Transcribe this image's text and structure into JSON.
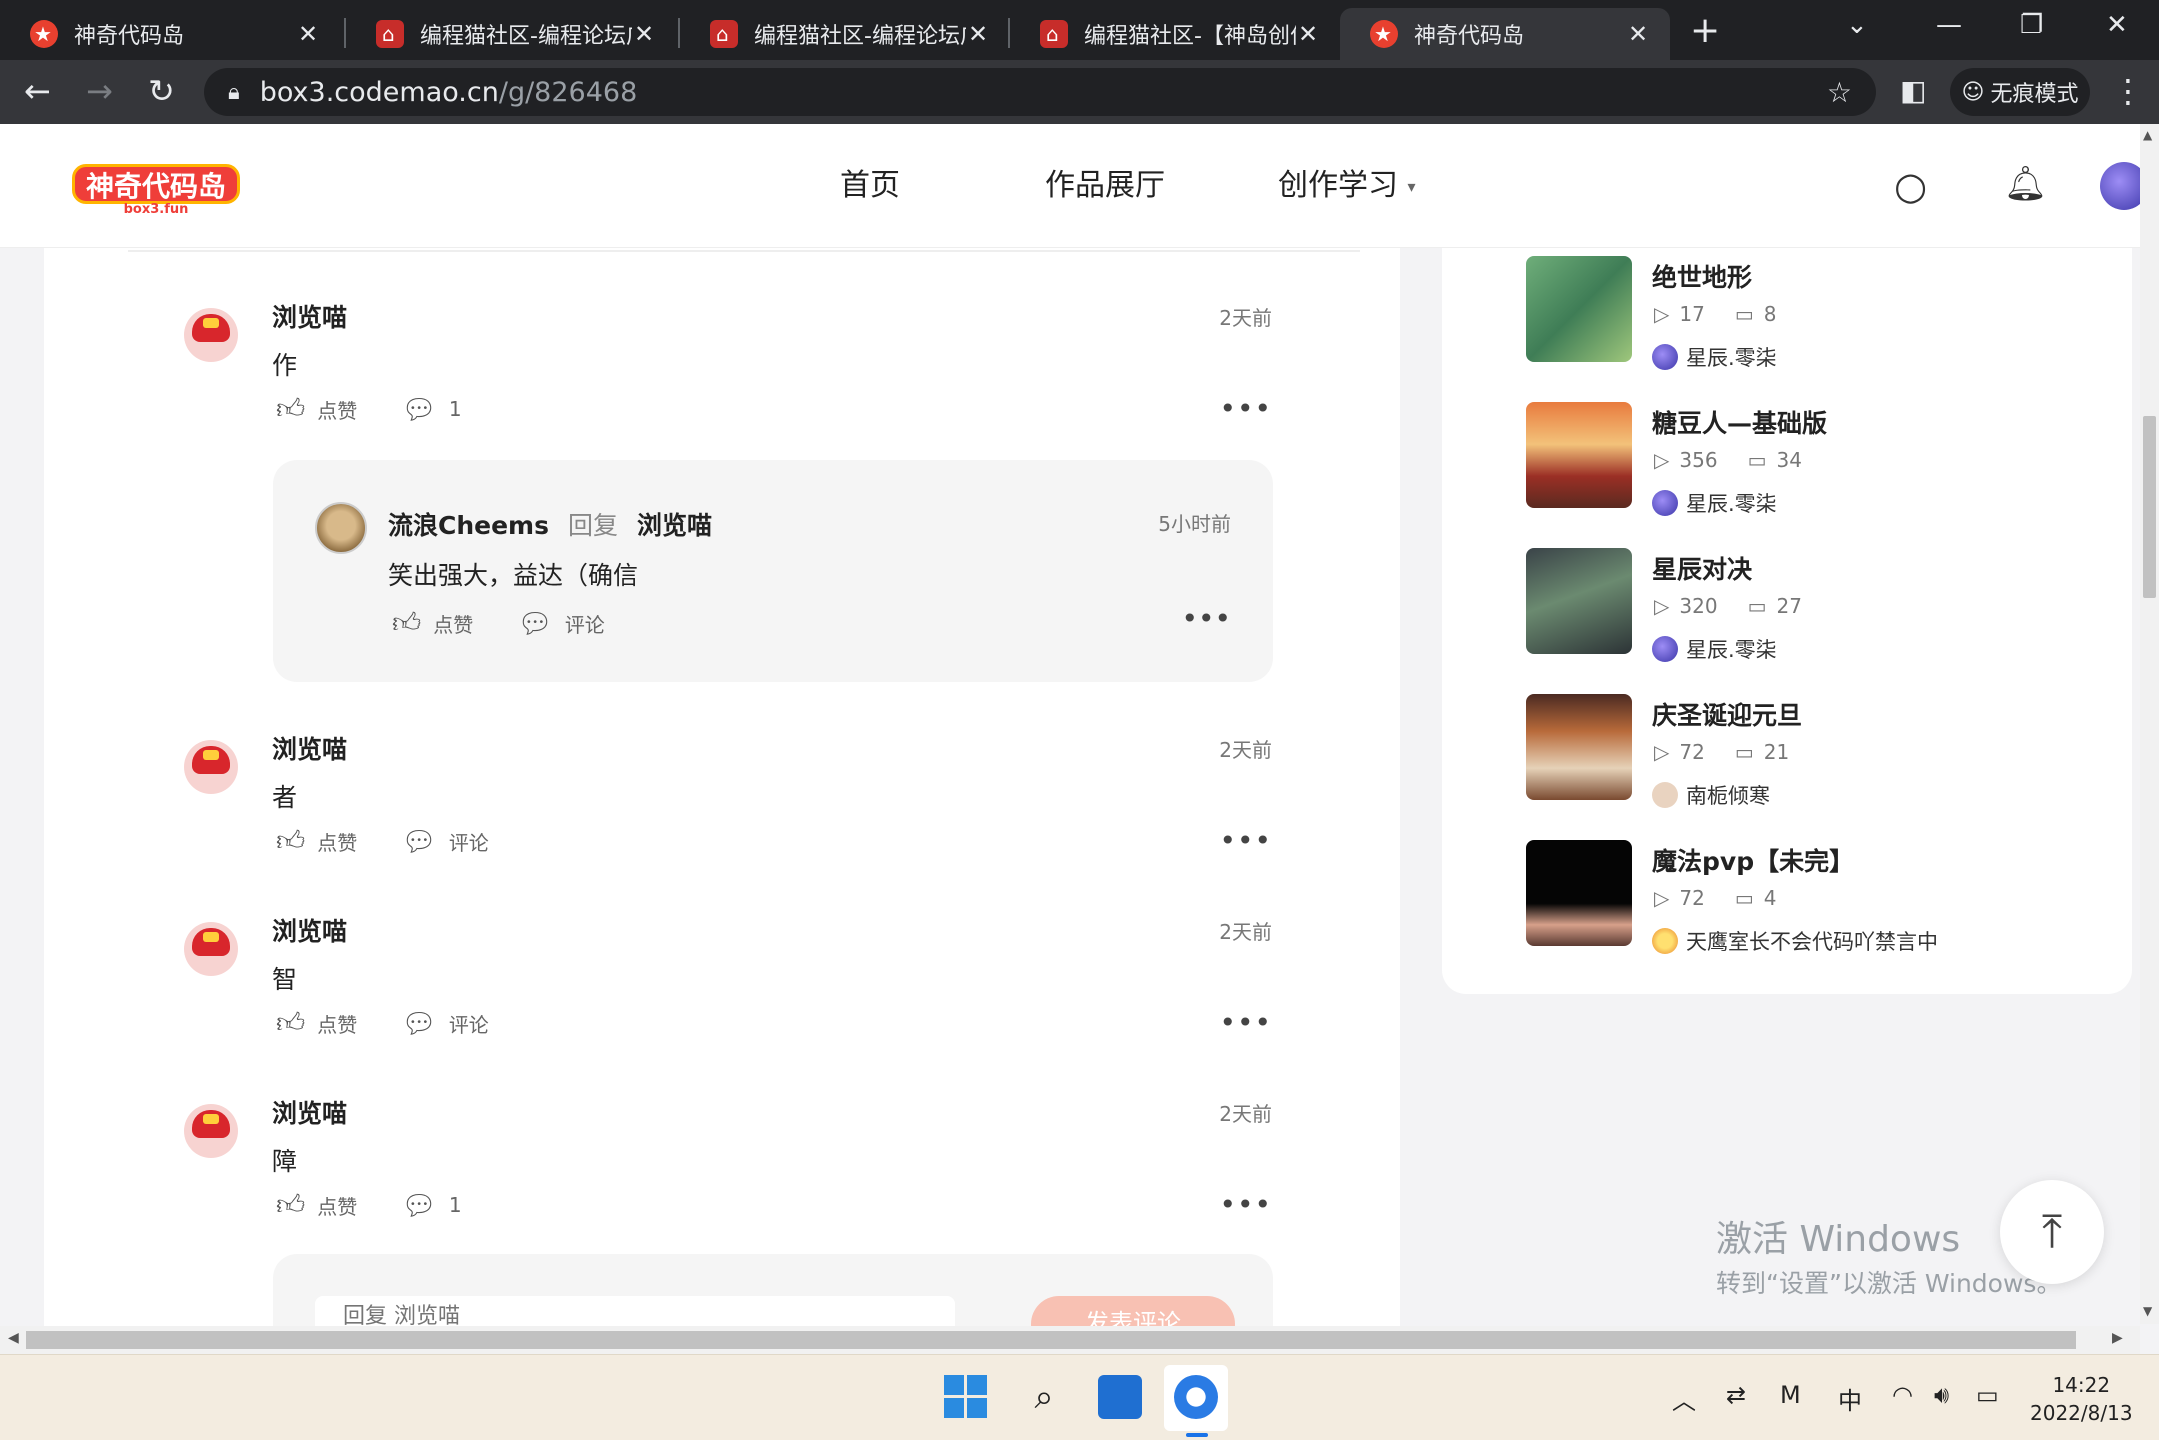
{
  "browser": {
    "tabs": [
      {
        "title": "神奇代码岛",
        "close": "✕",
        "icon": "star-favicon"
      },
      {
        "title": "编程猫社区-编程论坛广",
        "close": "✕",
        "icon": "codemao-favicon"
      },
      {
        "title": "编程猫社区-编程论坛广",
        "close": "✕",
        "icon": "codemao-favicon"
      },
      {
        "title": "编程猫社区-【神岛创作",
        "close": "✕",
        "icon": "codemao-favicon"
      },
      {
        "title": "神奇代码岛",
        "close": "✕",
        "icon": "star-favicon"
      }
    ],
    "new_tab": "+",
    "url_host": "box3.codemao.cn",
    "url_path": "/g/826468",
    "incognito_label": "无痕模式"
  },
  "site": {
    "logo_text": "神奇代码岛",
    "logo_sub": "box3.fun",
    "nav": [
      {
        "label": "首页"
      },
      {
        "label": "作品展厅"
      },
      {
        "label": "创作学习",
        "caret": "▾"
      }
    ]
  },
  "comments": [
    {
      "user": "浏览喵",
      "time": "2天前",
      "text": "作",
      "like_label": "点赞",
      "comment_label": "1",
      "reply": {
        "user": "流浪Cheems",
        "reply_word": "回复",
        "target": "浏览喵",
        "time": "5小时前",
        "text": "笑出强大，益达（确信",
        "like_label": "点赞",
        "comment_label": "评论"
      }
    },
    {
      "user": "浏览喵",
      "time": "2天前",
      "text": "者",
      "like_label": "点赞",
      "comment_label": "评论"
    },
    {
      "user": "浏览喵",
      "time": "2天前",
      "text": "智",
      "like_label": "点赞",
      "comment_label": "评论"
    },
    {
      "user": "浏览喵",
      "time": "2天前",
      "text": "障",
      "like_label": "点赞",
      "comment_label": "1"
    }
  ],
  "compose": {
    "placeholder": "回复 浏览喵",
    "submit_label": "发表评论"
  },
  "related_games": [
    {
      "title": "绝世地形",
      "plays": "17",
      "comments": "8",
      "author": "星辰.零柒"
    },
    {
      "title": "糖豆人—基础版",
      "plays": "356",
      "comments": "34",
      "author": "星辰.零柒"
    },
    {
      "title": "星辰对决",
      "plays": "320",
      "comments": "27",
      "author": "星辰.零柒"
    },
    {
      "title": "庆圣诞迎元旦",
      "plays": "72",
      "comments": "21",
      "author": "南栀倾寒"
    },
    {
      "title": "魔法pvp【未完】",
      "plays": "72",
      "comments": "4",
      "author": "天鹰室长不会代码吖禁言中"
    }
  ],
  "watermark": {
    "line1": "激活 Windows",
    "line2": "转到“设置”以激活 Windows。"
  },
  "taskbar": {
    "ime": "中",
    "time": "14:22",
    "date": "2022/8/13"
  },
  "colors": {
    "brand_red": "#ef3e39",
    "submit_button": "#f8c1b3",
    "tab_bar": "#202124"
  }
}
